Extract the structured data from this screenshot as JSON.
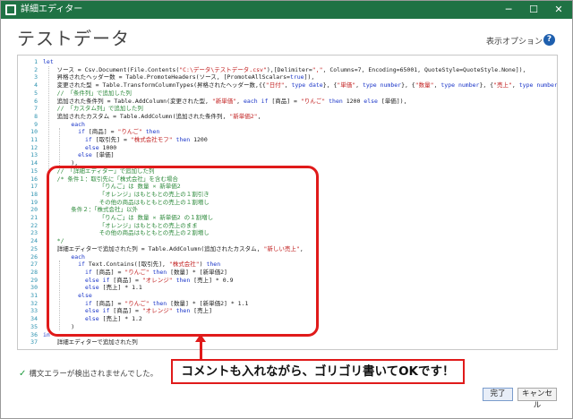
{
  "window": {
    "title": "詳細エディター",
    "min_label": "─",
    "max_label": "☐",
    "close_label": "✕"
  },
  "header": {
    "title": "テストデータ",
    "display_options": "表示オプション ▾",
    "help_label": "?"
  },
  "editor": {
    "lines": [
      {
        "n": "1",
        "text": "let"
      },
      {
        "n": "2",
        "text": "    ソース = Csv.Document(File.Contents(\"C:\\データ\\テストデータ.csv\"),[Delimiter=\",\", Columns=7, Encoding=65001, QuoteStyle=QuoteStyle.None]),"
      },
      {
        "n": "3",
        "text": "    昇格されたヘッダー数 = Table.PromoteHeaders(ソース, [PromoteAllScalars=true]),"
      },
      {
        "n": "4",
        "text": "    変更された型 = Table.TransformColumnTypes(昇格されたヘッダー数,{{\"日付\", type date}, {\"単価\", type number}, {\"数量\", type number}, {\"売上\", type number}}),"
      },
      {
        "n": "5",
        "text": "    // 「条件列」で追加した列"
      },
      {
        "n": "6",
        "text": "    追加された条件列 = Table.AddColumn(変更された型, \"新単価\", each if [商品] = \"りんご\" then 1200 else [単価]),"
      },
      {
        "n": "7",
        "text": "    // 「カスタム列」で追加した列"
      },
      {
        "n": "8",
        "text": "    追加されたカスタム = Table.AddColumn(追加された条件列, \"新単価2\","
      },
      {
        "n": "9",
        "text": "        each"
      },
      {
        "n": "10",
        "text": "          if [商品] = \"りんご\" then"
      },
      {
        "n": "11",
        "text": "            if [取引先] = \"株式会社モフ\" then 1200"
      },
      {
        "n": "12",
        "text": "            else 1000"
      },
      {
        "n": "13",
        "text": "          else [単価]"
      },
      {
        "n": "14",
        "text": "        ),"
      },
      {
        "n": "15",
        "text": "    // 「詳細エディター」で追加した列"
      },
      {
        "n": "16",
        "text": "    /* 条件１：取引先に「株式会社」を含む場合"
      },
      {
        "n": "17",
        "text": "                「りんご」は 数量 × 新単価2"
      },
      {
        "n": "18",
        "text": "                「オレンジ」はもともとの売上の１割引き"
      },
      {
        "n": "19",
        "text": "                その他の商品はもともとの売上の１割増し"
      },
      {
        "n": "20",
        "text": "        条件２：「株式会社」以外"
      },
      {
        "n": "21",
        "text": "                「りんご」は 数量 × 新単価2 の１割増し"
      },
      {
        "n": "22",
        "text": "                「オレンジ」はもともとの売上のまま"
      },
      {
        "n": "23",
        "text": "                その他の商品はもともとの売上の２割増し"
      },
      {
        "n": "24",
        "text": "    */"
      },
      {
        "n": "25",
        "text": "    詳細エディターで追加された列 = Table.AddColumn(追加されたカスタム, \"新しい売上\","
      },
      {
        "n": "26",
        "text": "        each"
      },
      {
        "n": "27",
        "text": "          if Text.Contains([取引先], \"株式会社\") then"
      },
      {
        "n": "28",
        "text": "            if [商品] = \"りんご\" then [数量] * [新単価2]"
      },
      {
        "n": "29",
        "text": "            else if [商品] = \"オレンジ\" then [売上] * 0.9"
      },
      {
        "n": "30",
        "text": "            else [売上] * 1.1"
      },
      {
        "n": "31",
        "text": "          else"
      },
      {
        "n": "32",
        "text": "            if [商品] = \"りんご\" then [数量] * [新単価2] * 1.1"
      },
      {
        "n": "33",
        "text": "            else if [商品] = \"オレンジ\" then [売上]"
      },
      {
        "n": "34",
        "text": "            else [売上] * 1.2"
      },
      {
        "n": "35",
        "text": "        )"
      },
      {
        "n": "36",
        "text": "in"
      },
      {
        "n": "37",
        "text": "    詳細エディターで追加された列"
      }
    ]
  },
  "annotation": {
    "callout": "コメントも入れながら、ゴリゴリ書いてOKです！"
  },
  "status": {
    "text": "構文エラーが検出されませんでした。",
    "icon": "check-icon"
  },
  "footer": {
    "ok_label": "完了",
    "cancel_label": "キャンセル"
  },
  "colors": {
    "titlebar": "#1f7244",
    "comment": "#2e8b3c",
    "keyword": "#1a35c8",
    "string": "#c22020",
    "highlight": "#e01a1a"
  }
}
